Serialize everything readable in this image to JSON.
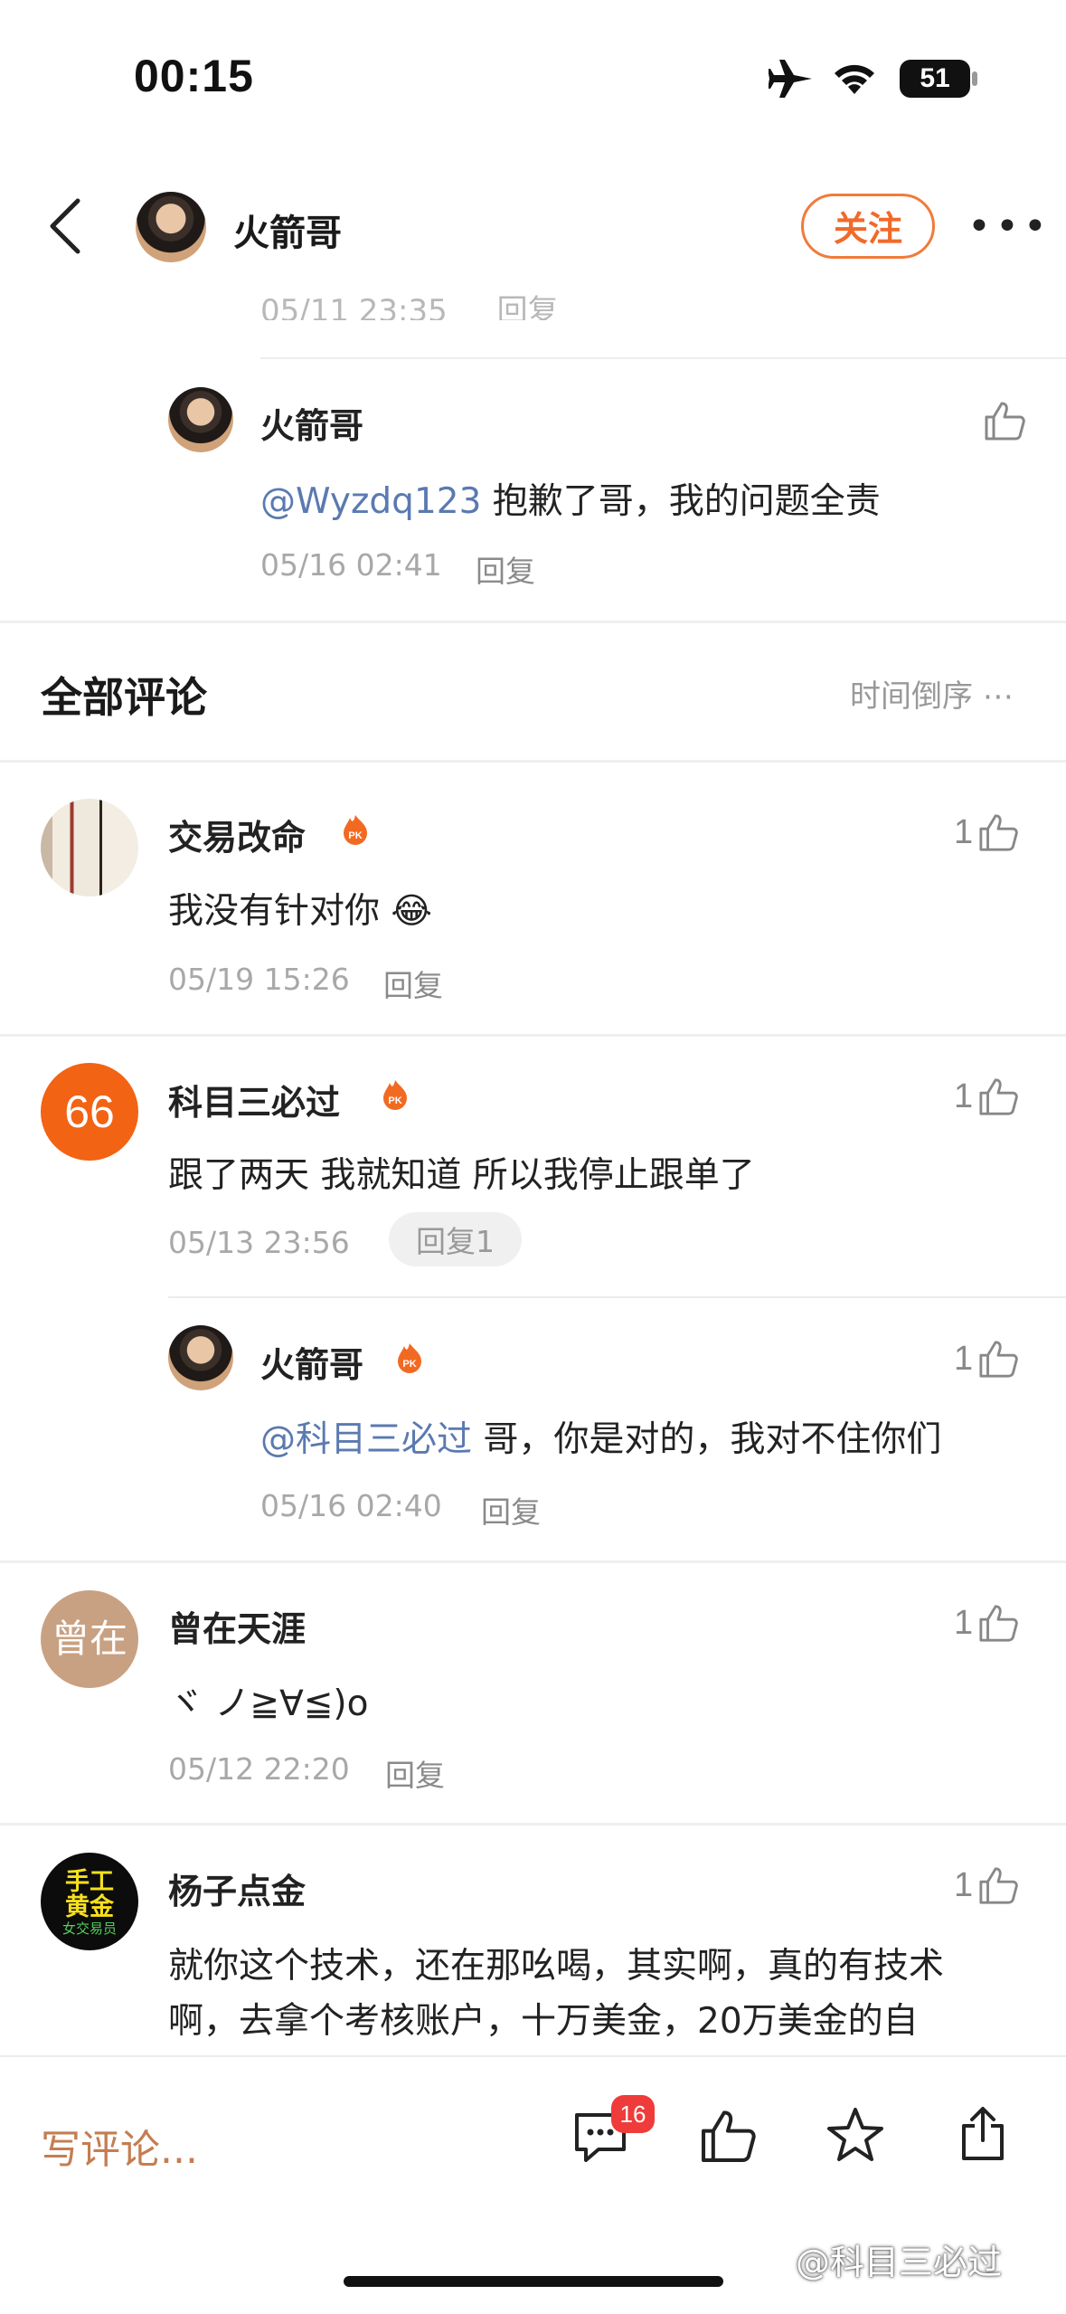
{
  "status_bar": {
    "time": "00:15",
    "battery": "51"
  },
  "nav": {
    "author_name": "火箭哥",
    "follow_label": "关注"
  },
  "prev_reply": {
    "clipped_time": "05/11 23:35",
    "clipped_reply": "回复",
    "name": "火箭哥",
    "mention": "@Wyzdq123",
    "text": " 抱歉了哥，我的问题全责",
    "time": "05/16 02:41",
    "reply_label": "回复"
  },
  "comments_header": {
    "title": "全部评论",
    "sort_label": "时间倒序"
  },
  "comments": [
    {
      "name": "交易改命",
      "text": "我没有针对你",
      "emoji": "😂",
      "time": "05/19 15:26",
      "reply_label": "回复",
      "likes": "1"
    },
    {
      "name": "科目三必过",
      "avatar_text": "66",
      "text": "跟了两天 我就知道 所以我停止跟单了",
      "time": "05/13 23:56",
      "reply_label": "回复1",
      "likes": "1",
      "sub_reply": {
        "name": "火箭哥",
        "mention": "@科目三必过",
        "text": " 哥，你是对的，我对不住你们",
        "time": "05/16 02:40",
        "reply_label": "回复",
        "likes": "1"
      }
    },
    {
      "name": "曾在天涯",
      "avatar_text": "曾在",
      "text": "ヾ ノ≧∀≦)o",
      "time": "05/12 22:20",
      "reply_label": "回复",
      "likes": "1"
    },
    {
      "name": "杨子点金",
      "avatar_lines": [
        "手工",
        "黄金",
        "女交易员"
      ],
      "text_line1": "就你这个技术，还在那吆喝，其实啊，真的有技术",
      "text_line2": "啊，去拿个考核账户，十万美金，20万美金的自",
      "likes": "1"
    }
  ],
  "bottom_bar": {
    "write_placeholder": "写评论...",
    "comment_count": "16"
  },
  "watermark": "@科目三必过",
  "colors": {
    "accent": "#f06a2a",
    "mention": "#5a7ab0",
    "badge": "#f03b3b"
  }
}
